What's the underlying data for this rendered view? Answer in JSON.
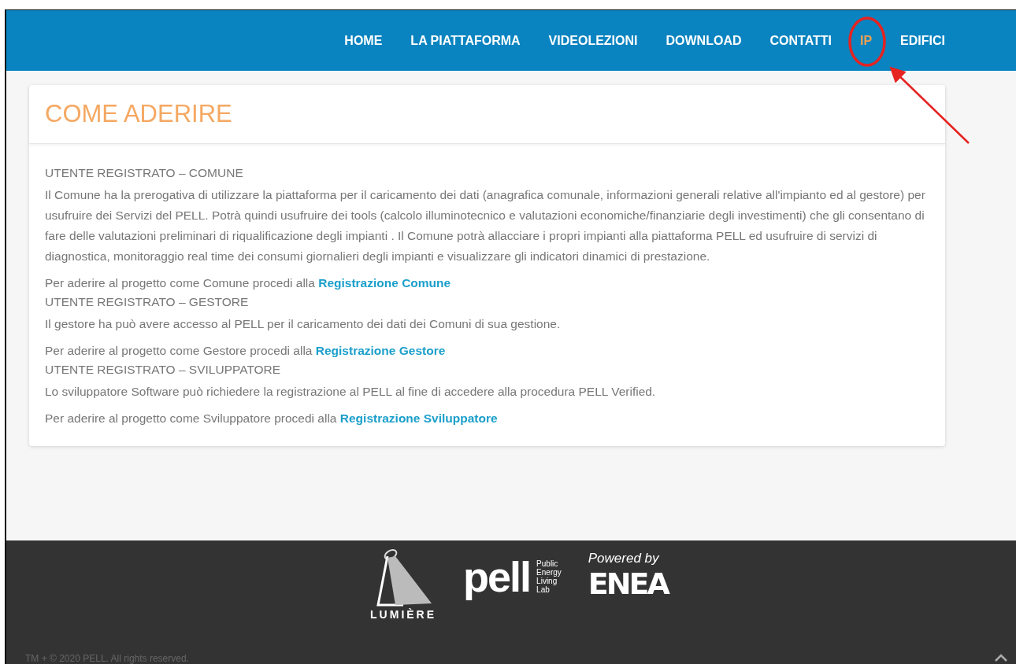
{
  "nav": [
    {
      "label": "HOME",
      "selected": false
    },
    {
      "label": "LA PIATTAFORMA",
      "selected": false
    },
    {
      "label": "VIDEOLEZIONI",
      "selected": false
    },
    {
      "label": "DOWNLOAD",
      "selected": false
    },
    {
      "label": "CONTATTI",
      "selected": false
    },
    {
      "label": "IP",
      "selected": true
    },
    {
      "label": "EDIFICI",
      "selected": false
    }
  ],
  "card": {
    "title": "COME ADERIRE",
    "blocks": [
      {
        "kind": "heading",
        "text": "UTENTE REGISTRATO – COMUNE"
      },
      {
        "kind": "paragraph",
        "text": "Il Comune ha la prerogativa di utilizzare la piattaforma per il caricamento dei dati (anagrafica comunale, informazioni generali relative all'impianto ed al gestore) per usufruire dei Servizi del PELL. Potrà quindi usufruire dei tools (calcolo illuminotecnico e valutazioni economiche/finanziarie degli investimenti) che gli consentano di fare delle valutazioni preliminari di riqualificazione degli impianti . Il Comune potrà allacciare i propri impianti alla piattaforma PELL ed usufruire di servizi di diagnostica, monitoraggio real time dei consumi giornalieri degli impianti e visualizzare gli indicatori dinamici di prestazione."
      },
      {
        "kind": "cta",
        "text": "Per aderire al progetto come Comune procedi alla",
        "link": "Registrazione Comune"
      },
      {
        "kind": "heading",
        "text": "UTENTE REGISTRATO – GESTORE"
      },
      {
        "kind": "paragraph",
        "text": "Il gestore ha può avere accesso al PELL per il caricamento dei dati dei Comuni di sua gestione."
      },
      {
        "kind": "cta",
        "text": "Per aderire al progetto come Gestore procedi alla",
        "link": "Registrazione Gestore"
      },
      {
        "kind": "heading",
        "text": "UTENTE REGISTRATO – SVILUPPATORE"
      },
      {
        "kind": "paragraph",
        "text": "Lo sviluppatore Software può richiedere la registrazione al PELL al fine di accedere alla procedura PELL Verified."
      },
      {
        "kind": "cta",
        "text": "Per aderire al progetto come Sviluppatore procedi alla",
        "link": "Registrazione Sviluppatore"
      }
    ]
  },
  "footer": {
    "lumiere": "LUMIÈRE",
    "pell": "pell",
    "pell_tagline": [
      "Public",
      "Energy",
      "Living",
      "Lab"
    ],
    "powered_by": "Powered by",
    "enea": "ENEA",
    "copyright": "TM + © 2020 PELL. All rights reserved."
  }
}
